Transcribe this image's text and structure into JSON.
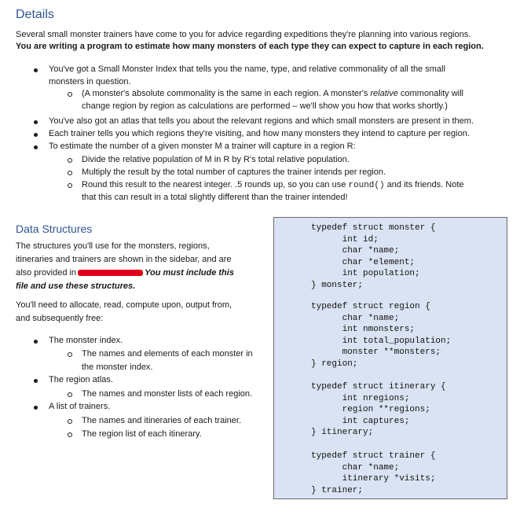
{
  "details": {
    "heading": "Details",
    "intro": "Several small monster trainers have come to you for advice regarding expeditions they're planning into various regions.",
    "intro_bold": "You are writing a program to estimate how many monsters of each type they can expect to capture in each region.",
    "b1_line1": "You've got a Small Monster Index that tells you the name, type, and relative commonality of all the small",
    "b1_line2": "monsters in question.",
    "b1a_line1_pre": "(A monster's absolute commonality is the same in each region.  A monster's ",
    "b1a_line1_ital": "relative",
    "b1a_line1_post": " commonality will",
    "b1a_line2": "change region by region as calculations are performed – we'll show you how that works shortly.)",
    "b2": "You've also got an atlas that tells you about the relevant regions and which small monsters are present in them.",
    "b3": "Each trainer tells you which regions they're visiting, and how many monsters they intend to capture per region.",
    "b4": "To estimate the number of a given monster M a trainer will capture in a region R:",
    "b4a": "Divide the relative population of M in R by R's total relative population.",
    "b4b": "Multiply the result by the total number of captures the trainer intends per region.",
    "b4c_pre": "Round this result to the nearest integer.  .5 rounds up, so you can use ",
    "b4c_code": "round()",
    "b4c_post": " and its friends.  Note",
    "b4c_line2": "that this can result in a total slightly different than the trainer intended!"
  },
  "data_structures": {
    "heading": "Data Structures",
    "p1_line1": "The structures you'll use for the monsters, regions,",
    "p1_line2": "itineraries and trainers are shown in the sidebar, and are",
    "p1_line3_pre": "also provided in",
    "p1_line3_ital": "You must include this",
    "p1_line4": "file and use these structures.",
    "p2_line1": "You'll need to allocate, read, compute upon, output from,",
    "p2_line2": "and subsequently free:",
    "l1": "The monster index.",
    "l1a_line1": "The names and elements of each monster in",
    "l1a_line2": "the monster index.",
    "l2": "The region atlas.",
    "l2a": "The names and monster lists of each region.",
    "l3": "A list of trainers.",
    "l3a": "The names and itineraries of each trainer.",
    "l3b": "The region list of each itinerary."
  },
  "code": {
    "monster": "typedef struct monster {\n      int id;\n      char *name;\n      char *element;\n      int population;\n} monster;",
    "region": "typedef struct region {\n      char *name;\n      int nmonsters;\n      int total_population;\n      monster **monsters;\n} region;",
    "itinerary": "typedef struct itinerary {\n      int nregions;\n      region **regions;\n      int captures;\n} itinerary;",
    "trainer": "typedef struct trainer {\n      char *name;\n      itinerary *visits;\n} trainer;"
  },
  "colors": {
    "heading": "#2f5496",
    "sidebar_bg": "#dae3f3",
    "redaction": "#e0001a"
  }
}
